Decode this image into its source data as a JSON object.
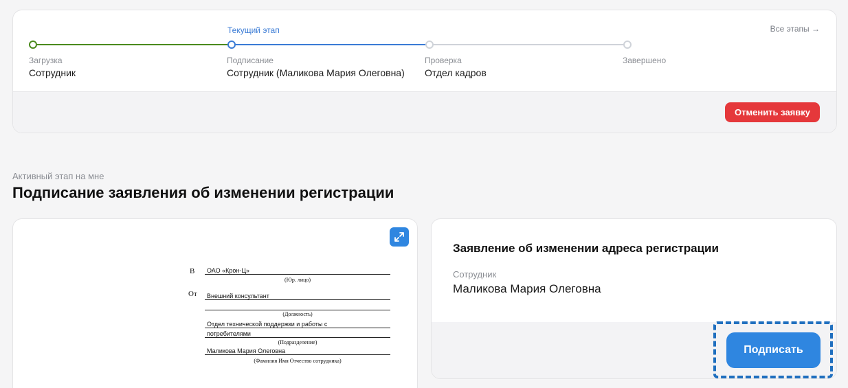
{
  "progress": {
    "all_stages_label": "Все этапы →",
    "current_stage_label": "Текущий этап",
    "stages": [
      {
        "name": "Загрузка",
        "actor": "Сотрудник",
        "status": "done"
      },
      {
        "name": "Подписание",
        "actor": "Сотрудник (Маликова Мария Олеговна)",
        "status": "current"
      },
      {
        "name": "Проверка",
        "actor": "Отдел кадров",
        "status": "pending"
      },
      {
        "name": "Завершено",
        "actor": "",
        "status": "pending"
      }
    ],
    "cancel_label": "Отменить заявку"
  },
  "section": {
    "subtitle": "Активный этап на мне",
    "title": "Подписание заявления об изменении регистрации"
  },
  "document": {
    "to_prefix": "В",
    "to_value": "ОАО «Крон-Ц»",
    "to_caption": "(Юр. лицо)",
    "from_prefix": "От",
    "position_value": "Внешний консультант",
    "position_caption": "(Должность)",
    "department_line1": "Отдел технической поддержки и работы с",
    "department_line2": "потребителями",
    "department_caption": "(Подразделение)",
    "employee_value": "Маликова Мария Олеговна",
    "employee_caption": "(Фамилия Имя Отчество сотрудника)"
  },
  "info": {
    "title": "Заявление об изменении адреса регистрации",
    "employee_label": "Сотрудник",
    "employee_name": "Маликова Мария Олеговна",
    "sign_label": "Подписать"
  },
  "colors": {
    "done": "#4b8a1d",
    "active": "#3a7bd5",
    "pending": "#cfd3d9",
    "danger": "#e5383b",
    "primary": "#2f86e0"
  },
  "icons": {
    "expand": "expand-arrows-icon"
  }
}
